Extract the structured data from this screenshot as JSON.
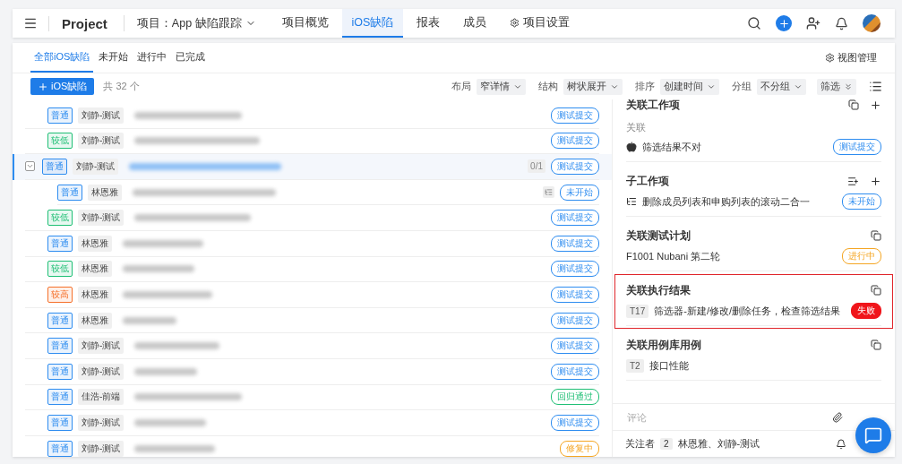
{
  "nav": {
    "title": "Project",
    "project": "项目：App 缺陷跟踪",
    "tabs": [
      {
        "label": "项目概览",
        "selected": false,
        "kind": "plain"
      },
      {
        "label": "iOS缺陷",
        "selected": true,
        "kind": "plain"
      },
      {
        "label": "报表",
        "selected": false,
        "kind": "plain"
      },
      {
        "label": "成员",
        "selected": false,
        "kind": "plain"
      },
      {
        "label": "项目设置",
        "selected": false,
        "kind": "settings"
      }
    ]
  },
  "view_tabs": [
    {
      "label": "全部iOS缺陷",
      "selected": true
    },
    {
      "label": "未开始",
      "selected": false
    },
    {
      "label": "进行中",
      "selected": false
    },
    {
      "label": "已完成",
      "selected": false
    }
  ],
  "view_manage": "视图管理",
  "toolbar": {
    "add_button": "iOS缺陷",
    "count": "共 32 个",
    "controls": [
      {
        "label": "布局",
        "value": "窄详情"
      },
      {
        "label": "结构",
        "value": "树状展开"
      },
      {
        "label": "排序",
        "value": "创建时间"
      },
      {
        "label": "分组",
        "value": "不分组"
      }
    ],
    "filter": "筛选"
  },
  "issues": [
    {
      "priority": {
        "label": "普通",
        "color": "#2d8cf0"
      },
      "assignee": "刘静-测试",
      "status": {
        "label": "测试提交",
        "color": "#2d8cf0"
      },
      "selected": false
    },
    {
      "priority": {
        "label": "较低",
        "color": "#1fbf75"
      },
      "assignee": "刘静-测试",
      "status": {
        "label": "测试提交",
        "color": "#2d8cf0"
      },
      "selected": false
    },
    {
      "priority": {
        "label": "普通",
        "color": "#2d8cf0"
      },
      "assignee": "刘静-测试",
      "status": {
        "label": "测试提交",
        "color": "#2d8cf0"
      },
      "selected": true,
      "expanded": true,
      "progress": "0/1",
      "children": [
        {
          "priority": {
            "label": "普通",
            "color": "#2d8cf0"
          },
          "assignee": "林恩雅",
          "status": {
            "label": "未开始",
            "color": "#2d8cf0"
          },
          "selected": false,
          "subtask": true
        }
      ]
    },
    {
      "priority": {
        "label": "较低",
        "color": "#1fbf75"
      },
      "assignee": "刘静-测试",
      "status": {
        "label": "测试提交",
        "color": "#2d8cf0"
      },
      "selected": false
    },
    {
      "priority": {
        "label": "普通",
        "color": "#2d8cf0"
      },
      "assignee": "林恩雅",
      "status": {
        "label": "测试提交",
        "color": "#2d8cf0"
      },
      "selected": false
    },
    {
      "priority": {
        "label": "较低",
        "color": "#1fbf75"
      },
      "assignee": "林恩雅",
      "status": {
        "label": "测试提交",
        "color": "#2d8cf0"
      },
      "selected": false
    },
    {
      "priority": {
        "label": "较高",
        "color": "#f5702a"
      },
      "assignee": "林恩雅",
      "status": {
        "label": "测试提交",
        "color": "#2d8cf0"
      },
      "selected": false
    },
    {
      "priority": {
        "label": "普通",
        "color": "#2d8cf0"
      },
      "assignee": "林恩雅",
      "status": {
        "label": "测试提交",
        "color": "#2d8cf0"
      },
      "selected": false
    },
    {
      "priority": {
        "label": "普通",
        "color": "#2d8cf0"
      },
      "assignee": "刘静-测试",
      "status": {
        "label": "测试提交",
        "color": "#2d8cf0"
      },
      "selected": false
    },
    {
      "priority": {
        "label": "普通",
        "color": "#2d8cf0"
      },
      "assignee": "刘静-测试",
      "status": {
        "label": "测试提交",
        "color": "#2d8cf0"
      },
      "selected": false
    },
    {
      "priority": {
        "label": "普通",
        "color": "#2d8cf0"
      },
      "assignee": "佳浩-前端",
      "status": {
        "label": "回归通过",
        "color": "#1fbf75"
      },
      "selected": false
    },
    {
      "priority": {
        "label": "普通",
        "color": "#2d8cf0"
      },
      "assignee": "刘静-测试",
      "status": {
        "label": "测试提交",
        "color": "#2d8cf0"
      },
      "selected": false
    },
    {
      "priority": {
        "label": "普通",
        "color": "#2d8cf0"
      },
      "assignee": "刘静-测试",
      "status": {
        "label": "修复中",
        "color": "#f5a623"
      },
      "selected": false
    }
  ],
  "detail": {
    "sections": [
      {
        "kind": "linked_items",
        "title": "关联工作项",
        "highlighted": false,
        "subheading": "关联",
        "items": [
          {
            "kind": "apple",
            "title": "筛选结果不对",
            "status": {
              "label": "测试提交",
              "color": "#2d8cf0",
              "kind": "outline"
            }
          }
        ]
      },
      {
        "kind": "subtasks",
        "title": "子工作项",
        "highlighted": false,
        "items": [
          {
            "kind": "subtask",
            "title": "删除成员列表和申购列表的滚动二合一",
            "status": {
              "label": "未开始",
              "color": "#2d8cf0",
              "kind": "outline"
            }
          }
        ]
      },
      {
        "kind": "link",
        "title": "关联测试计划",
        "highlighted": false,
        "items": [
          {
            "kind": "plain",
            "title": "F1001 Nubani 第二轮",
            "status": {
              "label": "进行中",
              "color": "#f5a623",
              "kind": "outline"
            }
          }
        ]
      },
      {
        "kind": "link",
        "title": "关联执行结果",
        "highlighted": true,
        "items": [
          {
            "kind": "code",
            "code": "T17",
            "title": "筛选器-新建/修改/删除任务，检查筛选结果",
            "status": {
              "label": "失败",
              "color": "#f0151b",
              "kind": "solid"
            }
          }
        ]
      },
      {
        "kind": "link",
        "title": "关联用例库用例",
        "highlighted": false,
        "items": [
          {
            "kind": "code",
            "code": "T2",
            "title": "接口性能"
          }
        ]
      }
    ],
    "comment": {
      "placeholder": "评论"
    },
    "followers": {
      "label": "关注者",
      "count": "2",
      "names": "林恩雅、刘静-测试"
    }
  }
}
